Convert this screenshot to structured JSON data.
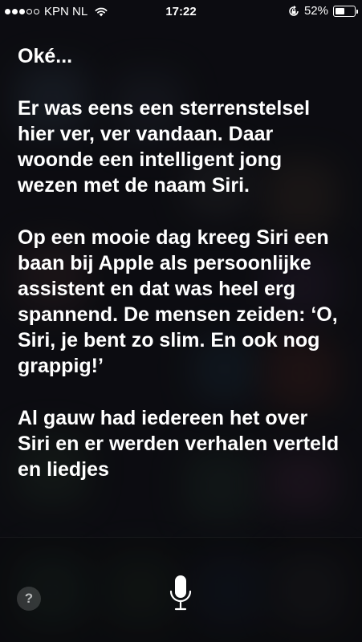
{
  "status_bar": {
    "carrier": "KPN NL",
    "signal_bars_filled": 3,
    "signal_bars_total": 5,
    "time": "17:22",
    "battery_percent": "52%",
    "battery_level": 0.52,
    "icons": [
      "signal-dots-icon",
      "wifi-icon",
      "rotation-lock-icon",
      "battery-icon"
    ]
  },
  "siri": {
    "acknowledgement": "Oké...",
    "paragraphs": [
      "Er was eens een sterrenstelsel hier ver, ver vandaan. Daar woonde een intelligent jong wezen met de naam Siri.",
      "Op een mooie dag kreeg Siri een baan bij Apple als persoonlijke assistent en dat was heel erg spannend. De mensen zeiden: ‘O, Siri, je bent zo slim. En ook nog grappig!’",
      "Al gauw had iedereen het over Siri en er werden verhalen verteld en liedjes"
    ]
  },
  "controls": {
    "help_label": "?",
    "mic_icon": "microphone-icon"
  }
}
